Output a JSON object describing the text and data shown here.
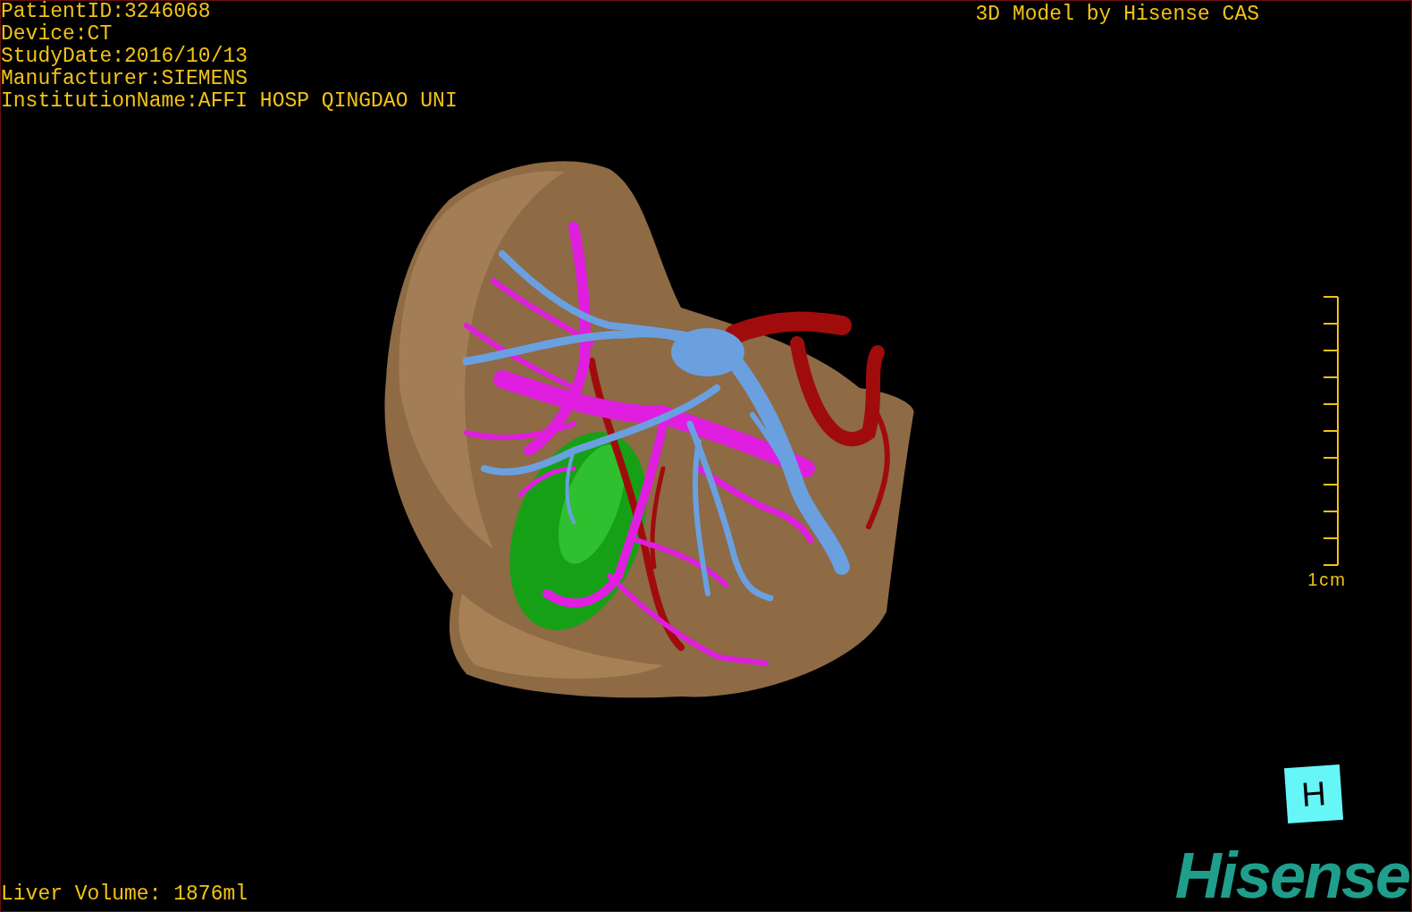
{
  "study_info": [
    "PatientID:3246068",
    "Device:CT",
    "StudyDate:2016/10/13",
    "Manufacturer:SIEMENS",
    "InstitutionName:AFFI HOSP QINGDAO UNI"
  ],
  "title": "3D Model by Hisense CAS",
  "scale_bar": {
    "label": "1cm"
  },
  "liver_volume": "Liver Volume: 1876ml",
  "orientation_cube": {
    "label": "H"
  },
  "logo": "Hisense"
}
